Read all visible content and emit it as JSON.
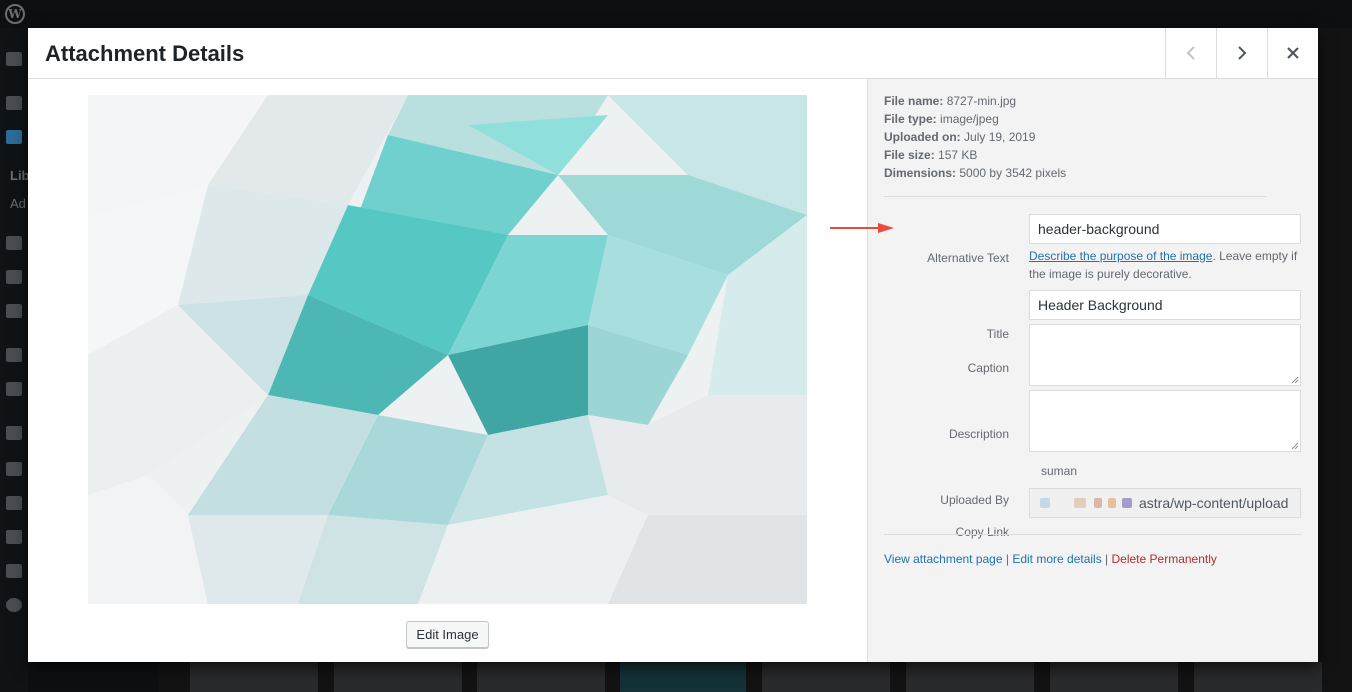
{
  "modal": {
    "title": "Attachment Details"
  },
  "file_info": [
    {
      "label": "File name:",
      "value": "8727-min.jpg"
    },
    {
      "label": "File type:",
      "value": "image/jpeg"
    },
    {
      "label": "Uploaded on:",
      "value": "July 19, 2019"
    },
    {
      "label": "File size:",
      "value": "157 KB"
    },
    {
      "label": "Dimensions:",
      "value": "5000 by 3542 pixels"
    }
  ],
  "fields": {
    "alt_text": {
      "label": "Alternative Text",
      "value": "header-background"
    },
    "alt_help_link": "Describe the purpose of the image",
    "alt_help_rest": ". Leave empty if the image is purely decorative.",
    "title": {
      "label": "Title",
      "value": "Header Background"
    },
    "caption": {
      "label": "Caption",
      "value": ""
    },
    "description": {
      "label": "Description",
      "value": ""
    },
    "uploaded_by": {
      "label": "Uploaded By",
      "value": "suman"
    },
    "copy_link": {
      "label": "Copy Link",
      "value": "astra/wp-content/upload"
    }
  },
  "actions": {
    "view": "View attachment page",
    "sep1": " | ",
    "edit": "Edit more details",
    "sep2": " | ",
    "delete": "Delete Permanently"
  },
  "edit_image_label": "Edit Image",
  "sidebar_text": {
    "lib": "Lib",
    "add": "Ad"
  },
  "icons": [
    "wordpress-logo-icon",
    "chevron-left-icon",
    "chevron-right-icon",
    "close-icon",
    "red-arrow-icon"
  ],
  "colors": {
    "link": "#2271b1",
    "danger": "#b32d2e",
    "teal": "#5fd1cc",
    "arrow": "#e74c3c"
  }
}
